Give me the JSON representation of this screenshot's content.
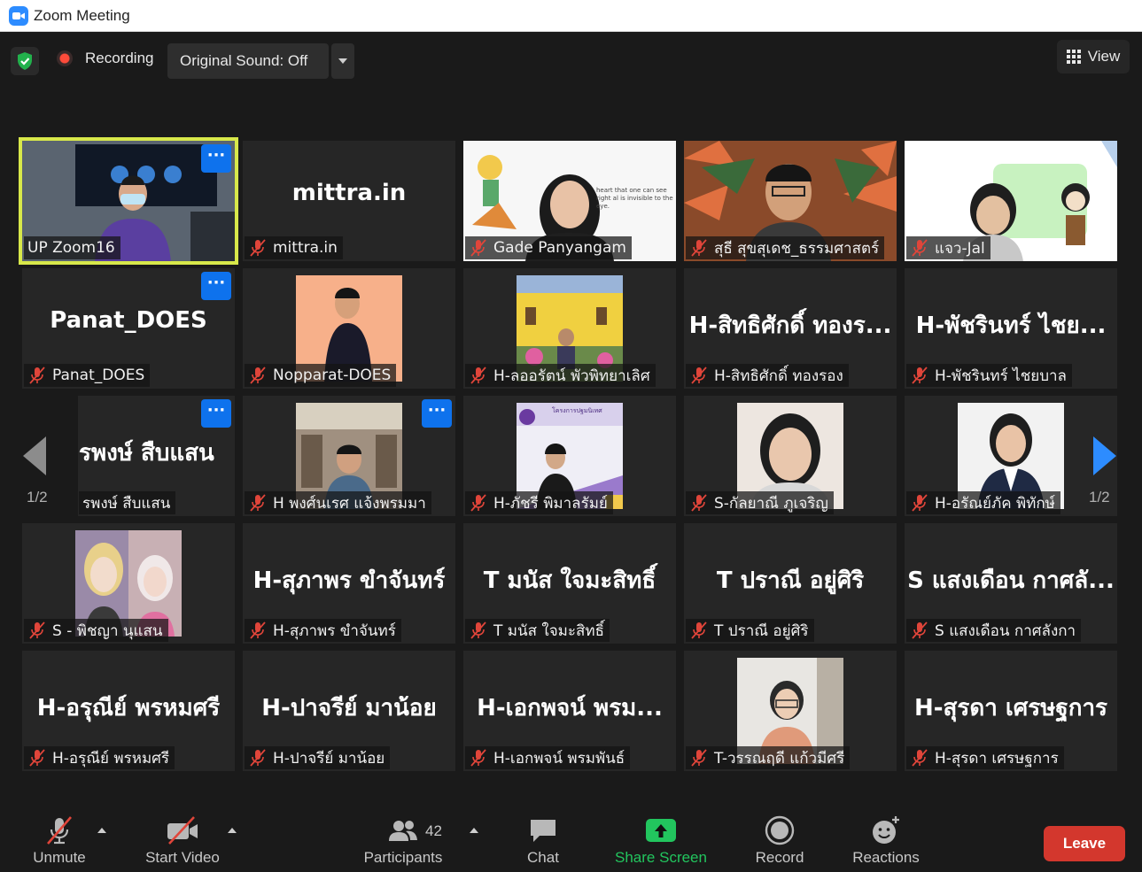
{
  "window": {
    "title": "Zoom Meeting"
  },
  "topbar": {
    "recording_label": "Recording",
    "original_sound_label": "Original Sound: Off",
    "view_label": "View"
  },
  "pagination": {
    "left_page": "1/2",
    "right_page": "1/2"
  },
  "tiles": [
    {
      "name": "UP Zoom16",
      "big": "",
      "muted": false,
      "video": true,
      "active": true,
      "more": true
    },
    {
      "name": "mittra.in",
      "big": "mittra.in",
      "muted": true,
      "video": false,
      "active": false,
      "more": false
    },
    {
      "name": "Gade Panyangam",
      "big": "",
      "muted": true,
      "video": true,
      "active": false,
      "more": false,
      "video_text": "heart that one can see right al is invisible to the eye."
    },
    {
      "name": "สุธี สุขสุเดช_ธรรมศาสตร์",
      "big": "",
      "muted": true,
      "video": true,
      "active": false,
      "more": false
    },
    {
      "name": "แจว-Jal",
      "big": "",
      "muted": true,
      "video": true,
      "active": false,
      "more": false
    },
    {
      "name": "Panat_DOES",
      "big": "Panat_DOES",
      "muted": true,
      "video": false,
      "active": false,
      "more": true
    },
    {
      "name": "Nopparat-DOES",
      "big": "",
      "muted": true,
      "video": true,
      "active": false,
      "more": false
    },
    {
      "name": "H-ลออรัตน์ พัวพิทยาเลิศ",
      "big": "",
      "muted": true,
      "video": true,
      "active": false,
      "more": false
    },
    {
      "name": "H-สิทธิศักดิ์ ทองรอง",
      "big": "H-สิทธิศักดิ์ ทองร...",
      "muted": true,
      "video": false,
      "active": false,
      "more": false
    },
    {
      "name": "H-พัชรินทร์ ไชยบาล",
      "big": "H-พัชรินทร์ ไชย...",
      "muted": true,
      "video": false,
      "active": false,
      "more": false
    },
    {
      "name": "รพงษ์ สืบแสน",
      "big": "รพงษ์ สืบแสน",
      "muted": false,
      "video": false,
      "active": false,
      "more": true
    },
    {
      "name": "H พงศ์นเรศ แจ้งพรมมา",
      "big": "",
      "muted": true,
      "video": true,
      "active": false,
      "more": true
    },
    {
      "name": "H-ภัชรี พิมาลรัมย์",
      "big": "",
      "muted": true,
      "video": true,
      "active": false,
      "more": false,
      "video_text": "โครงการปฐมนิเทศ"
    },
    {
      "name": "S-กัลยาณี ภูเจริญ",
      "big": "",
      "muted": true,
      "video": true,
      "active": false,
      "more": false
    },
    {
      "name": "H-อรัณย์ภัค พิทักษ์",
      "big": "",
      "muted": true,
      "video": true,
      "active": false,
      "more": false
    },
    {
      "name": "S - พิชญา นุแสน",
      "big": "",
      "muted": true,
      "video": true,
      "active": false,
      "more": false
    },
    {
      "name": "H-สุภาพร ขำจันทร์",
      "big": "H-สุภาพร ขำจันทร์",
      "muted": true,
      "video": false,
      "active": false,
      "more": false
    },
    {
      "name": "T มนัส ใจมะสิทธิ์",
      "big": "T มนัส ใจมะสิทธิ์",
      "muted": true,
      "video": false,
      "active": false,
      "more": false
    },
    {
      "name": "T ปราณี อยู่ศิริ",
      "big": "T ปราณี อยู่ศิริ",
      "muted": true,
      "video": false,
      "active": false,
      "more": false
    },
    {
      "name": "S แสงเดือน กาศลังกา",
      "big": "S แสงเดือน กาศลั...",
      "muted": true,
      "video": false,
      "active": false,
      "more": false
    },
    {
      "name": "H-อรุณีย์ พรหมศรี",
      "big": "H-อรุณีย์ พรหมศรี",
      "muted": true,
      "video": false,
      "active": false,
      "more": false
    },
    {
      "name": "H-ปาจรีย์ มาน้อย",
      "big": "H-ปาจรีย์ มาน้อย",
      "muted": true,
      "video": false,
      "active": false,
      "more": false
    },
    {
      "name": "H-เอกพจน์ พรมพันธ์",
      "big": "H-เอกพจน์ พรม...",
      "muted": true,
      "video": false,
      "active": false,
      "more": false
    },
    {
      "name": "T-วรรณฤดี แก้วมีศรี",
      "big": "",
      "muted": true,
      "video": true,
      "active": false,
      "more": false
    },
    {
      "name": "H-สุรดา เศรษฐการ",
      "big": "H-สุรดา เศรษฐการ",
      "muted": true,
      "video": false,
      "active": false,
      "more": false
    }
  ],
  "toolbar": {
    "unmute_label": "Unmute",
    "start_video_label": "Start Video",
    "participants_label": "Participants",
    "participants_count": "42",
    "chat_label": "Chat",
    "share_screen_label": "Share Screen",
    "record_label": "Record",
    "reactions_label": "Reactions",
    "leave_label": "Leave"
  },
  "colors": {
    "accent_blue": "#2d8cff",
    "active_speaker": "#d8e84a",
    "share_green": "#22c55e",
    "leave_red": "#d3372d",
    "mute_red": "#e0453a"
  }
}
